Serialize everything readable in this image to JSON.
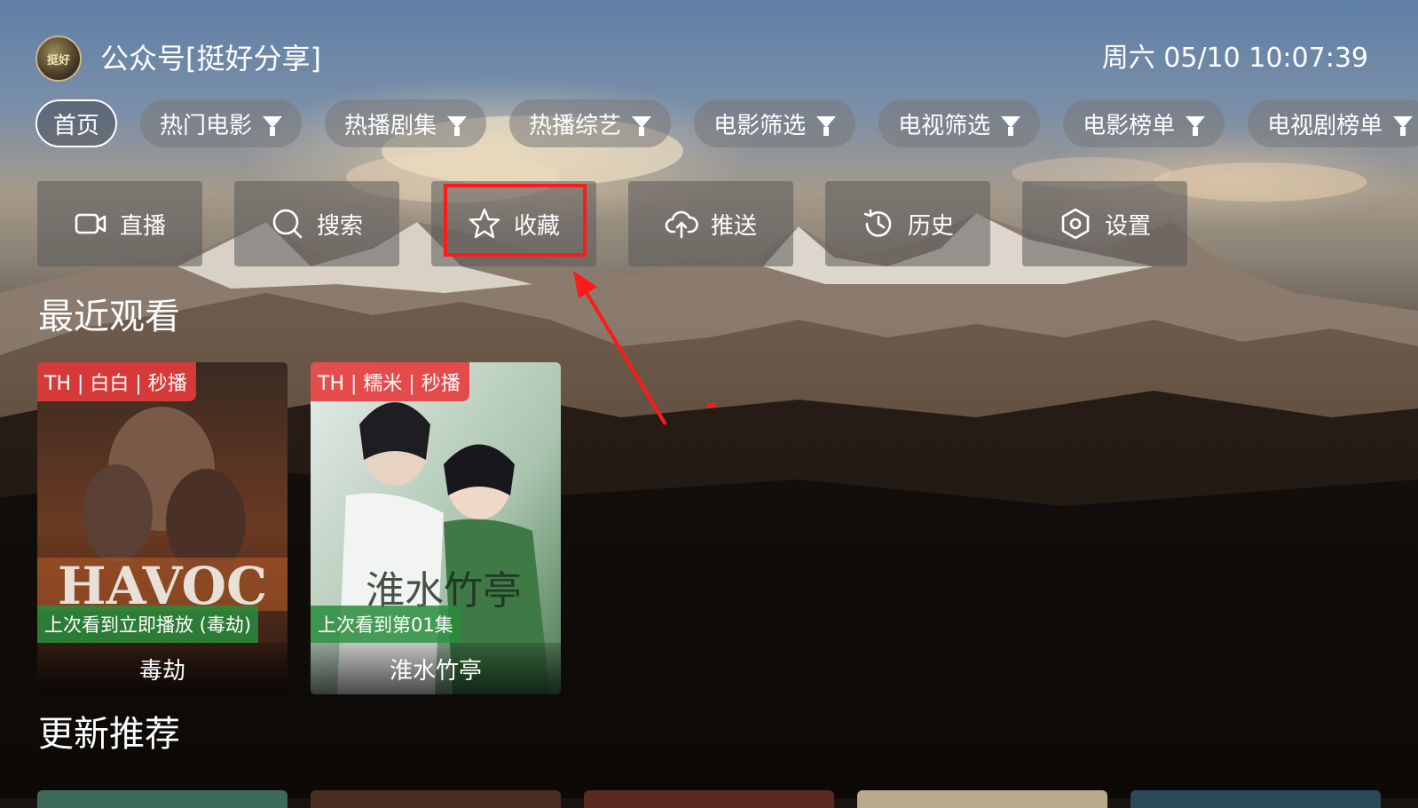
{
  "header": {
    "logo_text": "挺好",
    "title": "公众号[挺好分享]",
    "datetime": "周六 05/10 10:07:39"
  },
  "tabs": [
    {
      "label": "首页",
      "active": true,
      "filter": false
    },
    {
      "label": "热门电影",
      "filter": true
    },
    {
      "label": "热播剧集",
      "filter": true
    },
    {
      "label": "热播综艺",
      "filter": true
    },
    {
      "label": "电影筛选",
      "filter": true
    },
    {
      "label": "电视筛选",
      "filter": true
    },
    {
      "label": "电影榜单",
      "filter": true
    },
    {
      "label": "电视剧榜单",
      "filter": true
    }
  ],
  "actions": [
    {
      "label": "直播",
      "icon": "camera-icon"
    },
    {
      "label": "搜索",
      "icon": "search-icon"
    },
    {
      "label": "收藏",
      "icon": "star-icon",
      "highlighted": true
    },
    {
      "label": "推送",
      "icon": "cloud-upload-icon"
    },
    {
      "label": "历史",
      "icon": "history-icon"
    },
    {
      "label": "设置",
      "icon": "settings-icon"
    }
  ],
  "recent": {
    "title": "最近观看",
    "items": [
      {
        "badge": "TH | 白白 | 秒播",
        "progress": "上次看到立即播放 (毒劫)",
        "title": "毒劫",
        "poster_text": "HAVOC"
      },
      {
        "badge": "TH | 糯米 | 秒播",
        "progress": "上次看到第01集",
        "title": "淮水竹亭",
        "poster_text": "淮水竹亭"
      }
    ]
  },
  "updates": {
    "title": "更新推荐"
  },
  "colors": {
    "highlight": "#ff1a1a",
    "badge": "#e63c3c",
    "progress": "#288c3c"
  }
}
